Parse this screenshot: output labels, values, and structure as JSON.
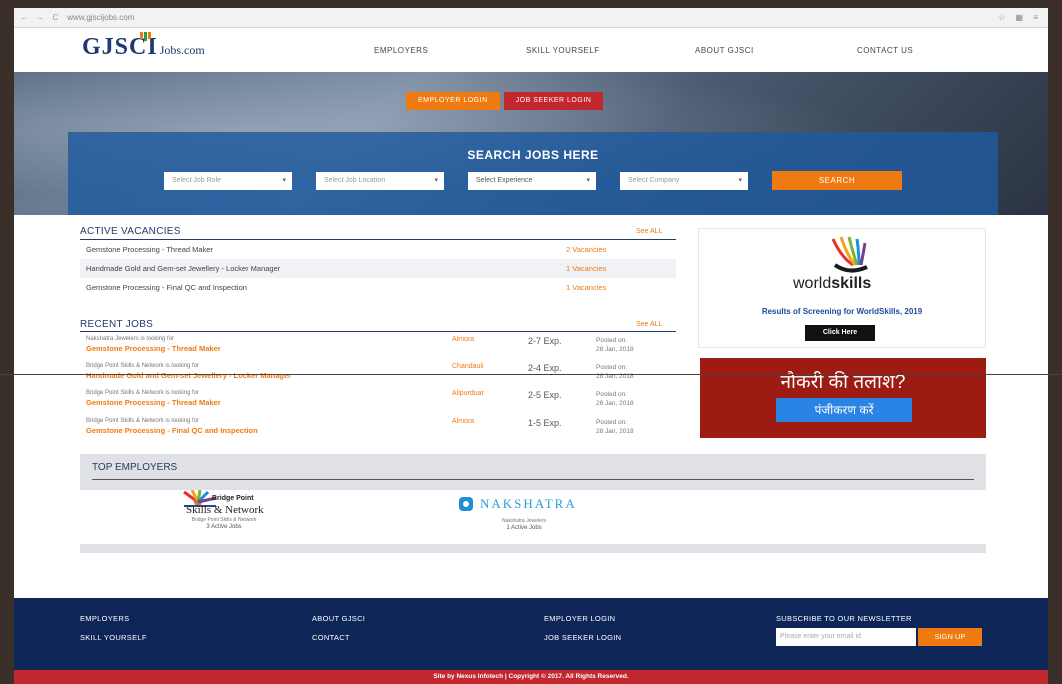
{
  "browser": {
    "url": "www.gjscijobs.com",
    "nav": "← → C",
    "right_icons": "☆ ▦ ≡"
  },
  "header": {
    "logo_big": "GJSCI",
    "logo_small": "Jobs.com",
    "nav": [
      "EMPLOYERS",
      "SKILL YOURSELF",
      "ABOUT GJSCI",
      "CONTACT US"
    ]
  },
  "hero": {
    "employer_login": "EMPLOYER LOGIN",
    "job_seeker_login": "JOB SEEKER LOGIN",
    "search_title": "SEARCH JOBS HERE",
    "selects": [
      "Select Job Role",
      "Select Job Location",
      "Select Experience",
      "Select Company"
    ],
    "search_button": "SEARCH"
  },
  "vacancies": {
    "title": "ACTIVE VACANCIES",
    "see_all": "See ALL",
    "rows": [
      {
        "role": "Gemstone Processing - Thread Maker",
        "count": "2 Vacancies"
      },
      {
        "role": "Handmade Gold and Gem-set Jewellery - Locker Manager",
        "count": "1 Vacancies"
      },
      {
        "role": "Gemstone Processing - Final QC and Inspection",
        "count": "1 Vacancies"
      }
    ]
  },
  "recent_jobs": {
    "title": "RECENT JOBS",
    "see_all": "See ALL",
    "rows": [
      {
        "company": "Nakshatra Jewelers is looking for",
        "role": "Gemstone Processing - Thread Maker",
        "location": "Almora",
        "exp": "2-7 Exp.",
        "posted_label": "Posted on:",
        "posted_date": "28 Jan, 2018"
      },
      {
        "company": "Bridge Point Skills & Network is looking for",
        "role": "Handmade Gold and Gem-set Jewellery - Locker Manager",
        "location": "Chandauli",
        "exp": "2-4 Exp.",
        "posted_label": "Posted on:",
        "posted_date": "28 Jan, 2018"
      },
      {
        "company": "Bridge Point Skills & Network is looking for",
        "role": "Gemstone Processing - Thread Maker",
        "location": "Alipurduar",
        "exp": "2-5 Exp.",
        "posted_label": "Posted on:",
        "posted_date": "28 Jan, 2018"
      },
      {
        "company": "Bridge Point Skills & Network is looking for",
        "role": "Gemstone Processing - Final QC and Inspection",
        "location": "Almora",
        "exp": "1-5 Exp.",
        "posted_label": "Posted on:",
        "posted_date": "28 Jan, 2018"
      }
    ]
  },
  "worldskills": {
    "word_light": "world",
    "word_bold": "skills",
    "caption": "Results of Screening for WorldSkills, 2019",
    "button": "Click Here"
  },
  "hindi_banner": {
    "title": "नौकरी की तलाश?",
    "button": "पंजीकरण करें"
  },
  "employers": {
    "title": "TOP EMPLOYERS",
    "cards": [
      {
        "name_line1": "Bridge Point",
        "name_line2": "Skills & Network",
        "sub": "Bridge Point Skills & Network",
        "jobs": "3 Active Jobs"
      },
      {
        "name": "NAKSHATRA",
        "sub": "Nakshatra Jewelers",
        "jobs": "1 Active Jobs"
      }
    ]
  },
  "footer": {
    "col1": [
      "EMPLOYERS",
      "SKILL YOURSELF"
    ],
    "col2": [
      "ABOUT GJSCI",
      "CONTACT"
    ],
    "col3": [
      "EMPLOYER LOGIN",
      "JOB SEEKER LOGIN"
    ],
    "newsletter_title": "SUBSCRIBE TO OUR NEWSLETTER",
    "newsletter_placeholder": "Please enter your email id",
    "signup": "SIGN UP",
    "copyright": "Site by Nexus Infotech | Copyright © 2017. All Rights Reserved."
  }
}
